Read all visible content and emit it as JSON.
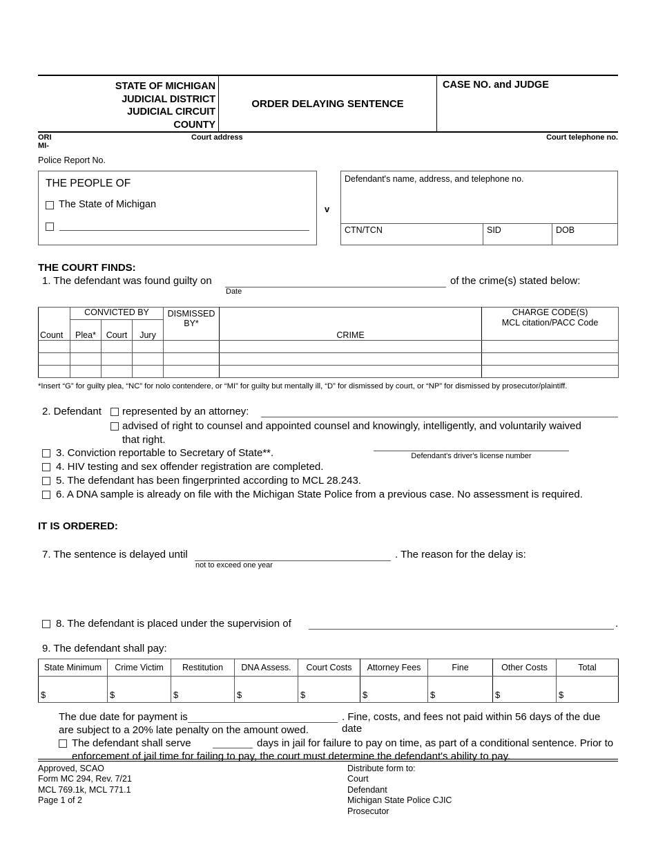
{
  "caption": {
    "left_lines": [
      "STATE OF MICHIGAN",
      "JUDICIAL DISTRICT",
      "JUDICIAL CIRCUIT",
      "COUNTY"
    ],
    "title": "ORDER DELAYING SENTENCE",
    "case_no_judge": "CASE NO. and JUDGE"
  },
  "ori": {
    "label": "ORI",
    "mi_prefix": "MI-",
    "court_address": "Court address",
    "court_telephone": "Court telephone no."
  },
  "police_report_label": "Police Report No.",
  "parties": {
    "people_of": "THE PEOPLE OF",
    "state_option": "The State of Michigan",
    "v": "v",
    "defendant_box_label": "Defendant's name, address, and telephone no.",
    "ctn_tcn": "CTN/TCN",
    "sid": "SID",
    "dob": "DOB"
  },
  "court_finds": {
    "heading": "THE COURT FINDS:",
    "item1_prefix": "1.  The defendant was found guilty on",
    "item1_date_label": "Date",
    "item1_suffix": "of the crime(s) stated below:"
  },
  "crime_table": {
    "headers": {
      "count": "Count",
      "convicted_by": "CONVICTED BY",
      "plea": "Plea*",
      "court": "Court",
      "jury": "Jury",
      "dismissed_by": "DISMISSED BY*",
      "crime": "CRIME",
      "charge_code_line1": "CHARGE CODE(S)",
      "charge_code_line2": "MCL citation/PACC Code"
    },
    "rows": [
      {
        "count": "",
        "plea": "",
        "court": "",
        "jury": "",
        "dismissed": "",
        "crime": "",
        "charge_code": ""
      },
      {
        "count": "",
        "plea": "",
        "court": "",
        "jury": "",
        "dismissed": "",
        "crime": "",
        "charge_code": ""
      },
      {
        "count": "",
        "plea": "",
        "court": "",
        "jury": "",
        "dismissed": "",
        "crime": "",
        "charge_code": ""
      }
    ],
    "footnote": "*Insert “G” for guilty plea, “NC” for nolo contendere, or “MI” for guilty but mentally ill, “D” for dismissed by court, or “NP” for dismissed by prosecutor/plaintiff."
  },
  "findings_items": {
    "item2_label": "2. Defendant",
    "item2_opt1": "represented by an attorney:",
    "item2_opt2_line1": "advised of right to counsel and appointed counsel and knowingly, intelligently, and voluntarily waived",
    "item2_opt2_line2": "that right.",
    "item3": "3. Conviction reportable to Secretary of State**.",
    "item4": "4. HIV testing and sex offender registration are completed.",
    "item5": "5. The defendant has been fingerprinted according to MCL 28.243.",
    "item6": "6. A DNA sample is already on file with the Michigan State Police from a previous case. No assessment is required.",
    "dl_label": "Defendant's driver's license number"
  },
  "ordered": {
    "heading": "IT IS ORDERED:",
    "item7_prefix": "7. The sentence is delayed until",
    "item7_sub": "not to exceed one year",
    "item7_suffix": ". The reason for the delay is:",
    "item8": "8. The defendant is placed under the supervision of",
    "item8_period": ".",
    "item9": "9. The defendant shall pay:"
  },
  "money_table": {
    "headers": [
      "State Minimum",
      "Crime Victim",
      "Restitution",
      "DNA Assess.",
      "Court Costs",
      "Attorney Fees",
      "Fine",
      "Other Costs",
      "Total"
    ],
    "values": [
      "$",
      "$",
      "$",
      "$",
      "$",
      "$",
      "$",
      "$",
      "$"
    ]
  },
  "due_paragraph": {
    "line1a": "The due date for payment is",
    "line1b": ". Fine, costs, and fees not paid within 56 days of the due date",
    "line2": "are subject to a 20% late penalty on the amount owed.",
    "line3a": "The defendant shall serve",
    "line3b": "days in jail for failure to pay on time, as part of a conditional sentence. Prior to",
    "line4": "enforcement of jail time for failing to pay, the court must determine the defendant's ability to pay."
  },
  "footer": {
    "left": [
      "Approved, SCAO",
      "Form MC 294, Rev. 7/21",
      "MCL 769.1k, MCL 771.1",
      "Page 1 of 2"
    ],
    "right": [
      "Distribute form to:",
      "Court",
      "Defendant",
      "Michigan State Police CJIC",
      "Prosecutor"
    ]
  }
}
